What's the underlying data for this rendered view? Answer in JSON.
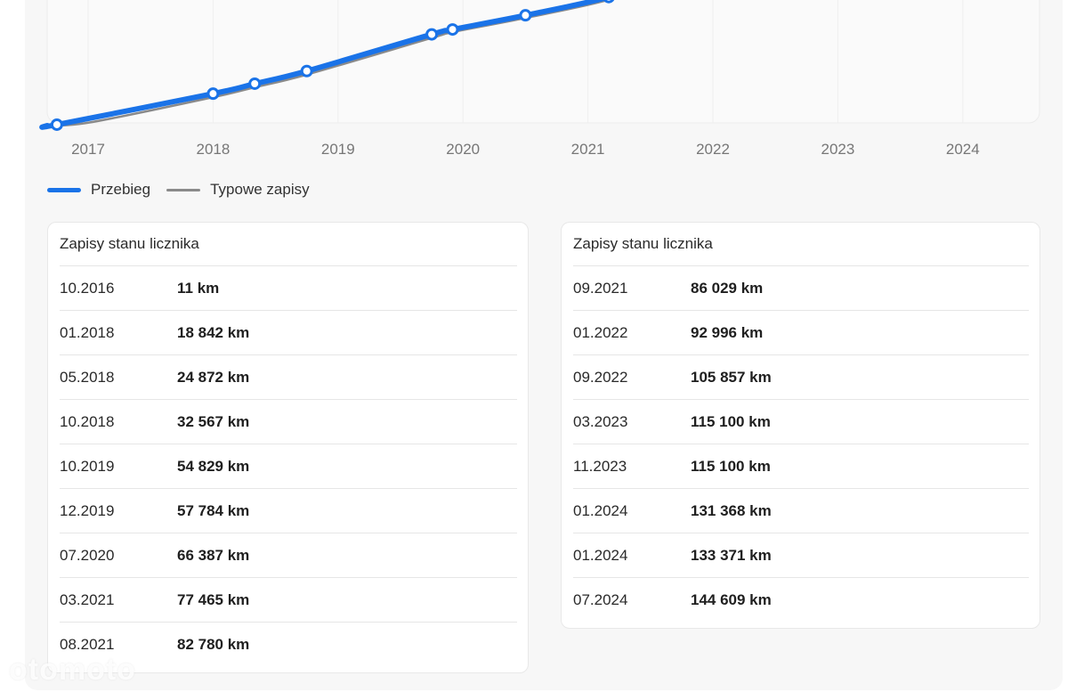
{
  "chart_data": {
    "type": "line",
    "x_ticks": [
      "2017",
      "2018",
      "2019",
      "2020",
      "2021",
      "2022",
      "2023",
      "2024"
    ],
    "series": [
      {
        "name": "Przebieg",
        "color": "#1a73e8",
        "points": [
          {
            "x": "10.2016",
            "y": 11
          },
          {
            "x": "01.2018",
            "y": 18842
          },
          {
            "x": "05.2018",
            "y": 24872
          },
          {
            "x": "10.2018",
            "y": 32567
          },
          {
            "x": "10.2019",
            "y": 54829
          },
          {
            "x": "12.2019",
            "y": 57784
          },
          {
            "x": "07.2020",
            "y": 66387
          },
          {
            "x": "03.2021",
            "y": 77465
          }
        ]
      },
      {
        "name": "Typowe zapisy",
        "color": "#8a8a8a"
      }
    ]
  },
  "legend": {
    "mileage_label": "Przebieg",
    "typical_label": "Typowe zapisy"
  },
  "tables": {
    "left": {
      "title": "Zapisy stanu licznika",
      "rows": [
        {
          "date": "10.2016",
          "km": "11 km"
        },
        {
          "date": "01.2018",
          "km": "18 842 km"
        },
        {
          "date": "05.2018",
          "km": "24 872 km"
        },
        {
          "date": "10.2018",
          "km": "32 567 km"
        },
        {
          "date": "10.2019",
          "km": "54 829 km"
        },
        {
          "date": "12.2019",
          "km": "57 784 km"
        },
        {
          "date": "07.2020",
          "km": "66 387 km"
        },
        {
          "date": "03.2021",
          "km": "77 465 km"
        },
        {
          "date": "08.2021",
          "km": "82 780 km"
        }
      ]
    },
    "right": {
      "title": "Zapisy stanu licznika",
      "rows": [
        {
          "date": "09.2021",
          "km": "86 029 km"
        },
        {
          "date": "01.2022",
          "km": "92 996 km"
        },
        {
          "date": "09.2022",
          "km": "105 857 km"
        },
        {
          "date": "03.2023",
          "km": "115 100 km"
        },
        {
          "date": "11.2023",
          "km": "115 100 km"
        },
        {
          "date": "01.2024",
          "km": "131 368 km"
        },
        {
          "date": "01.2024",
          "km": "133 371 km"
        },
        {
          "date": "07.2024",
          "km": "144 609 km"
        }
      ]
    }
  },
  "watermark": "otomoto"
}
